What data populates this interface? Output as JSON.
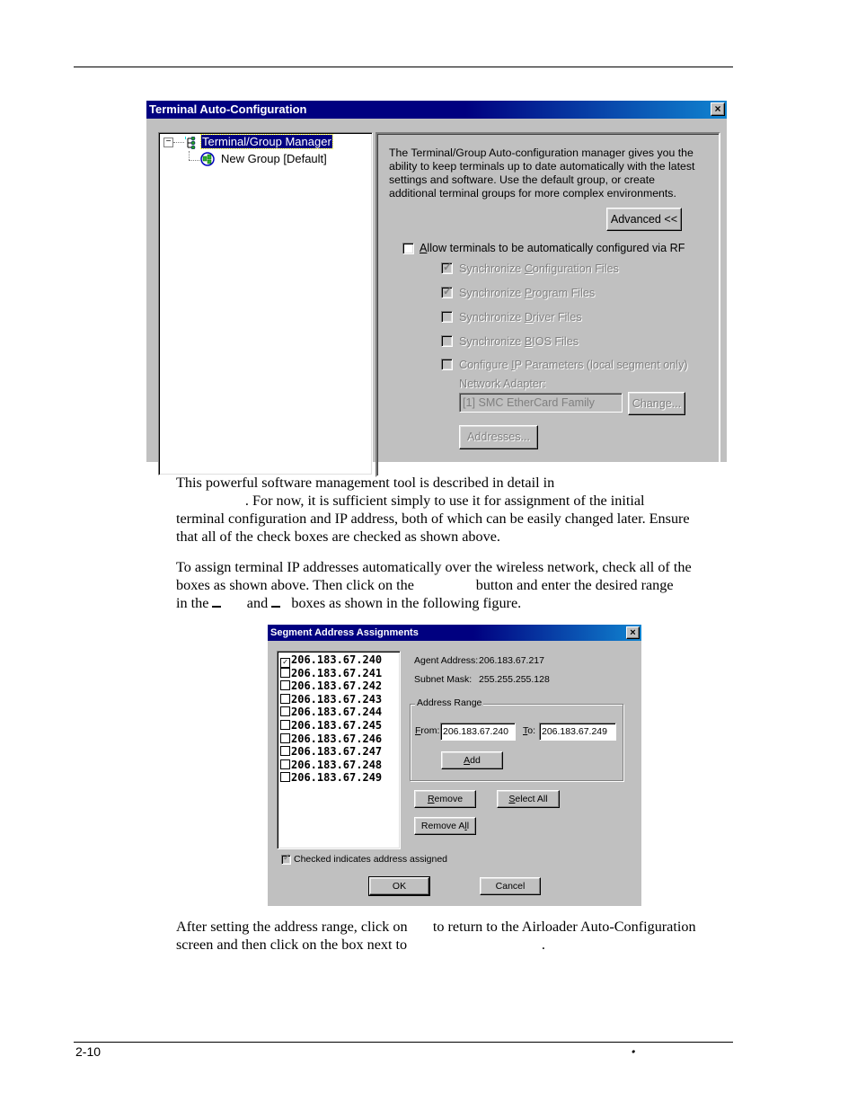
{
  "page": {
    "page_number": "2-10",
    "footer_bullet": "•"
  },
  "dialog1": {
    "title": "Terminal Auto-Configuration",
    "close_icon": "×",
    "tree": {
      "expander": "−",
      "items": [
        {
          "label": "Terminal/Group Manager",
          "icon": "group-manager-icon",
          "selected": true
        },
        {
          "label": "New Group [Default]",
          "icon": "terminal-group-icon",
          "selected": false
        }
      ]
    },
    "description": "The Terminal/Group Auto-configuration manager gives you the ability to keep terminals up to date automatically with the latest settings and software.  Use the default group, or create additional terminal groups for more complex environments.",
    "advanced_button": "Advanced <<",
    "allow_rf": {
      "label_u": "A",
      "label_rest": "llow terminals to be automatically configured via RF",
      "checked": false
    },
    "options": [
      {
        "pre": "Synchronize ",
        "u": "C",
        "post": "onfiguration Files",
        "checked": true,
        "enabled": false
      },
      {
        "pre": "Synchronize ",
        "u": "P",
        "post": "rogram Files",
        "checked": true,
        "enabled": false
      },
      {
        "pre": "Synchronize ",
        "u": "D",
        "post": "river Files",
        "checked": false,
        "enabled": false
      },
      {
        "pre": "Synchronize ",
        "u": "B",
        "post": "IOS Files",
        "checked": false,
        "enabled": false
      },
      {
        "pre": "Configure ",
        "u": "I",
        "post": "P Parameters (local segment only)",
        "checked": false,
        "enabled": false
      }
    ],
    "network_adapter_label": "Network Adapter:",
    "network_adapter_value": "[1] SMC EtherCard Family",
    "change_button": "Change...",
    "addresses_button": "Addresses..."
  },
  "paragraphs": {
    "p1": [
      "This powerful software management tool is described in detail in",
      "                   . For now, it is sufficient simply to use it for assignment of the initial",
      "terminal configuration and IP address, both of which can be easily changed later. Ensure",
      "that all of the check boxes are checked as shown above."
    ],
    "p2_line1": "To assign terminal IP addresses automatically over the wireless network, check all of the",
    "p2_line2": "boxes as shown above. Then click on the                 button and enter the desired range",
    "p2_line3_a": "in the ",
    "p2_line3_b": "       and ",
    "p2_line3_c": "   boxes as shown in the following figure.",
    "p3": [
      "After setting the address range, click on       to return to the Airloader Auto-Configuration",
      "screen and then click on the box next to                                     ."
    ]
  },
  "dialog2": {
    "title": "Segment Address Assignments",
    "close_icon": "×",
    "addresses": [
      {
        "ip": "206.183.67.240",
        "checked": true
      },
      {
        "ip": "206.183.67.241",
        "checked": false
      },
      {
        "ip": "206.183.67.242",
        "checked": false
      },
      {
        "ip": "206.183.67.243",
        "checked": false
      },
      {
        "ip": "206.183.67.244",
        "checked": false
      },
      {
        "ip": "206.183.67.245",
        "checked": false
      },
      {
        "ip": "206.183.67.246",
        "checked": false
      },
      {
        "ip": "206.183.67.247",
        "checked": false
      },
      {
        "ip": "206.183.67.248",
        "checked": false
      },
      {
        "ip": "206.183.67.249",
        "checked": false
      }
    ],
    "agent_address_label": "Agent Address:",
    "agent_address_value": "206.183.67.217",
    "subnet_mask_label": "Subnet Mask:",
    "subnet_mask_value": "255.255.255.128",
    "address_range_title": "Address Range",
    "from_label_u": "F",
    "from_label_rest": "rom:",
    "from_value": "206.183.67.240",
    "to_label_u": "T",
    "to_label_rest": "o:",
    "to_value": "206.183.67.249",
    "add_button_u": "A",
    "add_button_rest": "dd",
    "remove_button_u": "R",
    "remove_button_rest": "emove",
    "select_all_button_u": "S",
    "select_all_button_rest": "elect All",
    "remove_all_button_pre": "Remove A",
    "remove_all_button_u": "l",
    "remove_all_button_post": "l",
    "legend_checkbox_label": "Checked indicates address assigned",
    "legend_checked": true,
    "ok_button": "OK",
    "cancel_button": "Cancel"
  }
}
